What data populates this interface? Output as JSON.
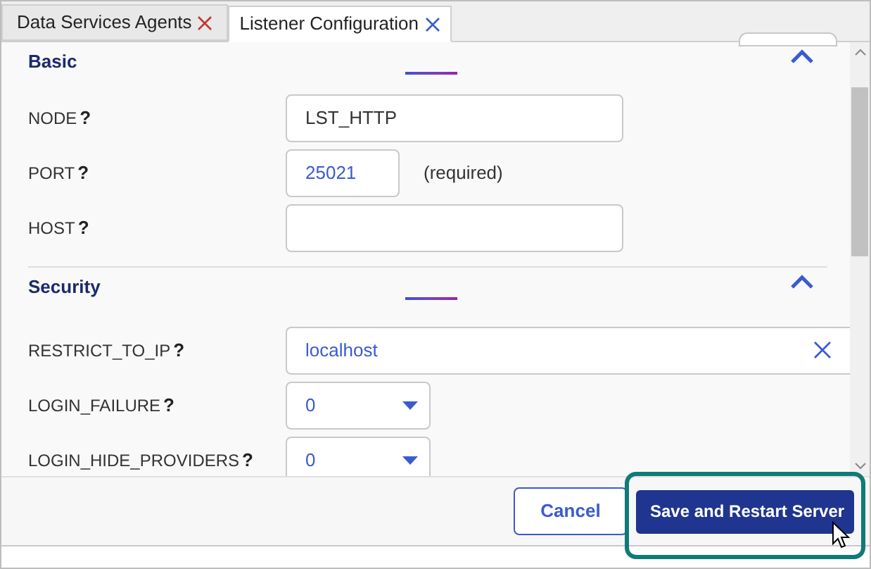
{
  "tabs": [
    {
      "label": "Data Services Agents",
      "selected": false
    },
    {
      "label": "Listener Configuration",
      "selected": true
    }
  ],
  "sections": [
    {
      "title": "Basic",
      "expanded": true,
      "fields": [
        {
          "kind": "text",
          "label": "NODE",
          "hint": "?",
          "value": "LST_HTTP"
        },
        {
          "kind": "number",
          "label": "PORT",
          "hint": "?",
          "value": "25021",
          "note": "(required)"
        },
        {
          "kind": "text",
          "label": "HOST",
          "hint": "?"
        }
      ]
    },
    {
      "title": "Security",
      "expanded": true,
      "fields": [
        {
          "kind": "clearable",
          "label": "RESTRICT_TO_IP",
          "hint": "?",
          "value": "localhost"
        },
        {
          "kind": "select",
          "label": "LOGIN_FAILURE",
          "hint": "?",
          "value": "0"
        },
        {
          "kind": "select",
          "label": "LOGIN_HIDE_PROVIDERS",
          "hint": "?",
          "value": "0"
        }
      ]
    }
  ],
  "buttons": [
    {
      "label": "Cancel",
      "kind": "secondary"
    },
    {
      "label": "Save and Restart Server",
      "kind": "primary"
    }
  ]
}
